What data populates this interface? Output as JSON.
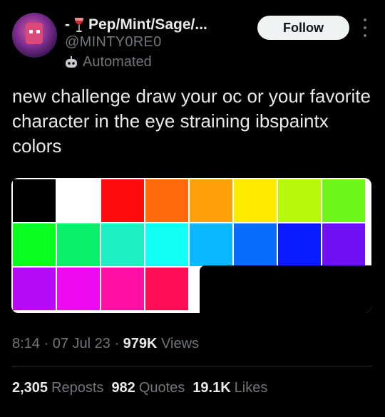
{
  "header": {
    "prefix": "-",
    "display_name": "Pep/Mint/Sage/...",
    "handle": "@MINTY0RE0",
    "automated_label": "Automated",
    "follow_label": "Follow"
  },
  "tweet": {
    "text": "new challenge draw your oc or your favorite character in the eye straining ibspaintx colors"
  },
  "palette": {
    "rows": [
      [
        "#000000",
        "#ffffff",
        "#ff0d0d",
        "#ff6a0a",
        "#ffa10a",
        "#ffea00",
        "#b8f70a",
        "#6ef51a"
      ],
      [
        "#0aff1f",
        "#0af06c",
        "#1af0c2",
        "#12fff5",
        "#0ab8ff",
        "#0a6cff",
        "#0a1cff",
        "#6f10f5"
      ],
      [
        "#b40af5",
        "#f00af0",
        "#ff0fa4",
        "#ff0d55"
      ]
    ]
  },
  "meta": {
    "time": "8:14",
    "date": "07 Jul 23",
    "views_count": "979K",
    "views_label": "Views"
  },
  "stats": {
    "reposts_count": "2,305",
    "reposts_label": "Reposts",
    "quotes_count": "982",
    "quotes_label": "Quotes",
    "likes_count": "19.1K",
    "likes_label": "Likes"
  },
  "icons": {
    "wine": "wine-glass-icon",
    "bot": "automated-bot-icon",
    "more": "more-vertical-icon"
  }
}
